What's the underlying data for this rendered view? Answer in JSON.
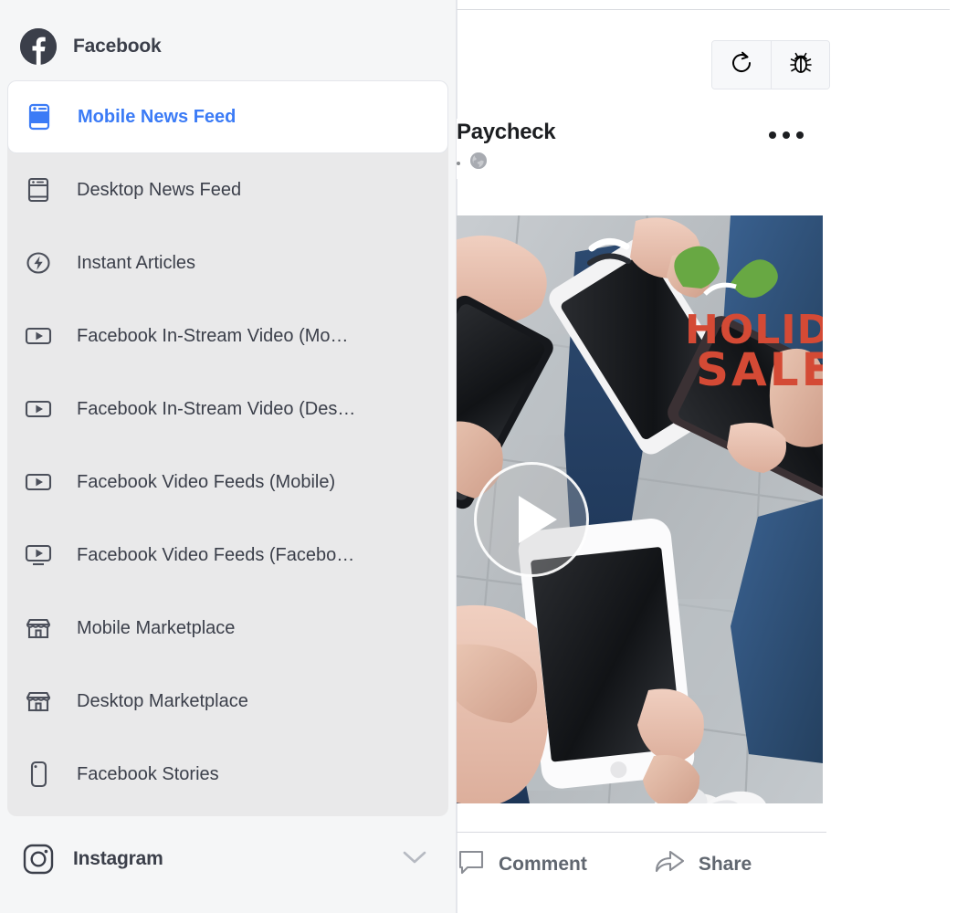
{
  "sidebar": {
    "platform": {
      "name": "Facebook",
      "icon": "facebook-logo-icon"
    },
    "items": [
      {
        "label": "Mobile News Feed",
        "icon": "mobile-news-feed-icon",
        "selected": true
      },
      {
        "label": "Desktop News Feed",
        "icon": "desktop-news-feed-icon",
        "selected": false
      },
      {
        "label": "Instant Articles",
        "icon": "instant-articles-icon",
        "selected": false
      },
      {
        "label": "Facebook In-Stream Video (Mo…",
        "icon": "video-icon",
        "selected": false
      },
      {
        "label": "Facebook In-Stream Video (Des…",
        "icon": "video-icon",
        "selected": false
      },
      {
        "label": "Facebook Video Feeds (Mobile)",
        "icon": "video-icon",
        "selected": false
      },
      {
        "label": "Facebook Video Feeds (Facebo…",
        "icon": "video-desktop-icon",
        "selected": false
      },
      {
        "label": "Mobile Marketplace",
        "icon": "marketplace-icon",
        "selected": false
      },
      {
        "label": "Desktop Marketplace",
        "icon": "marketplace-icon",
        "selected": false
      },
      {
        "label": "Facebook Stories",
        "icon": "stories-icon",
        "selected": false
      }
    ],
    "next_platform": {
      "name": "Instagram",
      "icon": "instagram-icon",
      "chevron": "chevron-down-icon"
    }
  },
  "preview": {
    "toolbar": [
      {
        "name": "refresh-button",
        "icon": "refresh-icon"
      },
      {
        "name": "debug-button",
        "icon": "bug-icon"
      }
    ],
    "post": {
      "page_name": "Paycheck",
      "privacy_icon": "globe-icon",
      "menu_icon": "more-options-icon",
      "media": {
        "type": "video",
        "play_icon": "play-icon",
        "overlay_text_line1": "HOLIDAY",
        "overlay_text_line2": "SALE"
      },
      "actions": [
        {
          "label": "Comment",
          "icon": "comment-icon"
        },
        {
          "label": "Share",
          "icon": "share-icon"
        }
      ]
    }
  },
  "colors": {
    "accent_blue": "#3b7bf6",
    "text_dark": "#3b3f4a",
    "text_title": "#1c1e21",
    "action_gray": "#616770",
    "sidebar_bg": "#f5f6f7",
    "list_bg": "#e9e9ea",
    "border": "#e4e6eb",
    "overlay_red": "#d44a35",
    "overlay_green": "#68a843"
  }
}
